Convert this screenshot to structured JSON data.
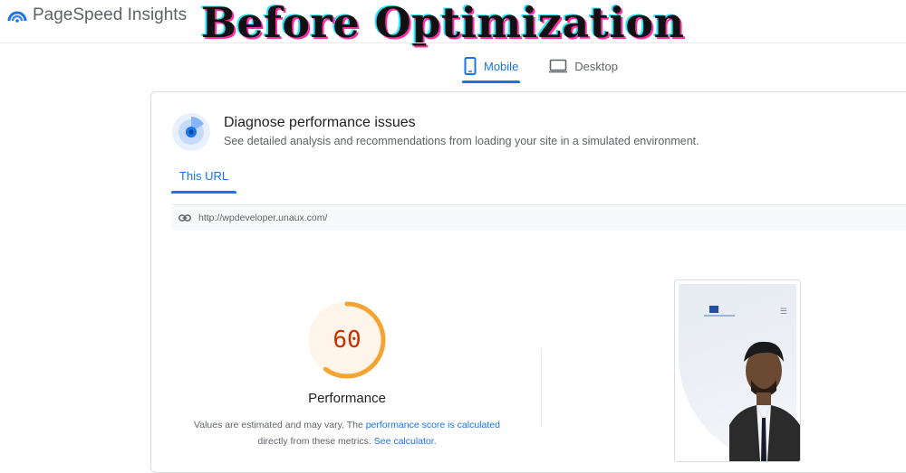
{
  "app": {
    "logo_text": "PageSpeed Insights",
    "overlay_title": "Before Optimization",
    "accent_color": "#1a73e8",
    "score_color": "#c33300",
    "gauge_color": "#f4a432"
  },
  "device_tabs": [
    {
      "label": "Mobile",
      "icon": "mobile-icon",
      "active": true
    },
    {
      "label": "Desktop",
      "icon": "desktop-icon",
      "active": false
    }
  ],
  "diagnose": {
    "title": "Diagnose performance issues",
    "subtitle": "See detailed analysis and recommendations from loading your site in a simulated environment."
  },
  "url_tab": {
    "label": "This URL",
    "active": true
  },
  "url": {
    "value": "http://wpdeveloper.unaux.com/",
    "icon": "link-icon"
  },
  "performance": {
    "score": "60",
    "score_fraction": 0.6,
    "label": "Performance",
    "note_prefix": "Values are estimated and may vary. The ",
    "note_link": "performance score is calculated",
    "note_mid": " directly from these metrics. ",
    "note_link2": "See calculator",
    "note_suffix": "."
  },
  "preview": {
    "menu_icon": "hamburger-icon",
    "logo_text": "YB"
  }
}
